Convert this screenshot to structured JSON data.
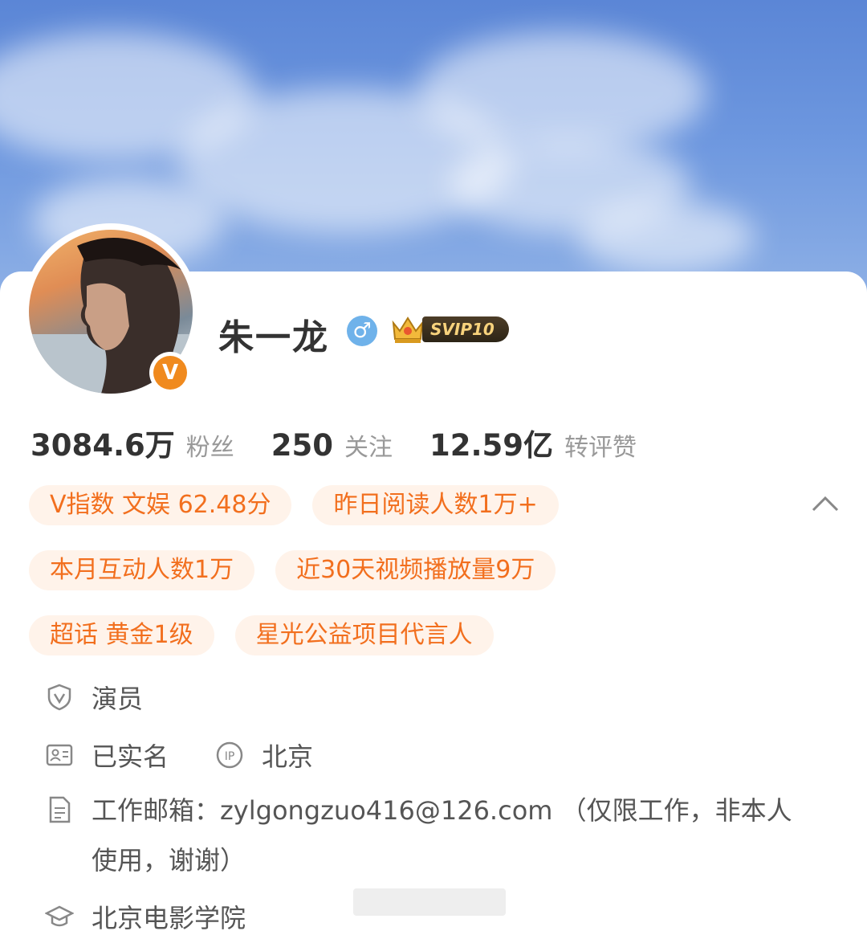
{
  "profile": {
    "name": "朱一龙",
    "gender_symbol": "♂",
    "verified_symbol": "V",
    "vip_badge": "SVIP10"
  },
  "stats": [
    {
      "value": "3084.6万",
      "label": "粉丝"
    },
    {
      "value": "250",
      "label": "关注"
    },
    {
      "value": "12.59亿",
      "label": "转评赞"
    }
  ],
  "tags": {
    "row1": [
      "V指数 文娱 62.48分",
      "昨日阅读人数1万+"
    ],
    "row2": [
      "本月互动人数1万",
      "近30天视频播放量9万"
    ],
    "row3": [
      "超话 黄金1级",
      "星光公益项目代言人"
    ]
  },
  "info": {
    "occupation": "演员",
    "real_name": "已实名",
    "ip_location": "北京",
    "work_email": "工作邮箱：zylgongzuo416@126.com （仅限工作，非本人使用，谢谢）",
    "school": "北京电影学院"
  },
  "icons": {
    "collapse": "chevron-up-icon",
    "occupation": "shield-v-icon",
    "real_name": "id-card-icon",
    "ip": "ip-icon",
    "email": "document-icon",
    "school": "graduation-cap-icon"
  },
  "colors": {
    "accent": "#f26f1e",
    "tag_bg": "#fff3ea",
    "verified": "#f08a1e",
    "gender": "#6fb2ea"
  }
}
